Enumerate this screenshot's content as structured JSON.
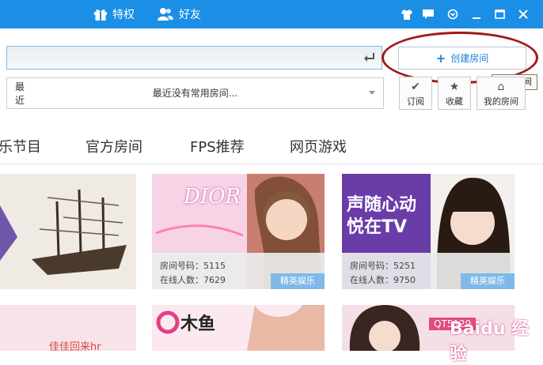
{
  "titlebar": {
    "perks_label": "特权",
    "friends_label": "好友"
  },
  "search": {
    "value": "",
    "placeholder": ""
  },
  "create_room": {
    "label": "创建房间",
    "tooltip": "创建房间"
  },
  "recent": {
    "label": "最近",
    "empty_text": "最近没有常用房间..."
  },
  "side_buttons": {
    "subscribe": "订阅",
    "favorite": "收藏",
    "my_room": "我的房间"
  },
  "tabs": [
    "乐节目",
    "官方房间",
    "FPS推荐",
    "网页游戏"
  ],
  "cards": [
    {
      "art_text": "DIOR",
      "room_id_label": "房间号码：5115",
      "online_label": "在线人数：7629",
      "badge": "精英娱乐"
    },
    {
      "art_text": "声随心动 悦在TV",
      "room_id_label": "房间号码：5251",
      "online_label": "在线人数：9750",
      "badge": "精英娱乐"
    }
  ],
  "lower_cards": {
    "tag_a": "佳佳回来hr",
    "tag_b": "木鱼",
    "tag_c": "QT5129"
  },
  "colors": {
    "titlebar": "#1b8fe6",
    "accent_text": "#1e80d8",
    "badge": "#7fb9ea",
    "annotation": "#a31a1a"
  },
  "watermark": "Baidu 经验"
}
